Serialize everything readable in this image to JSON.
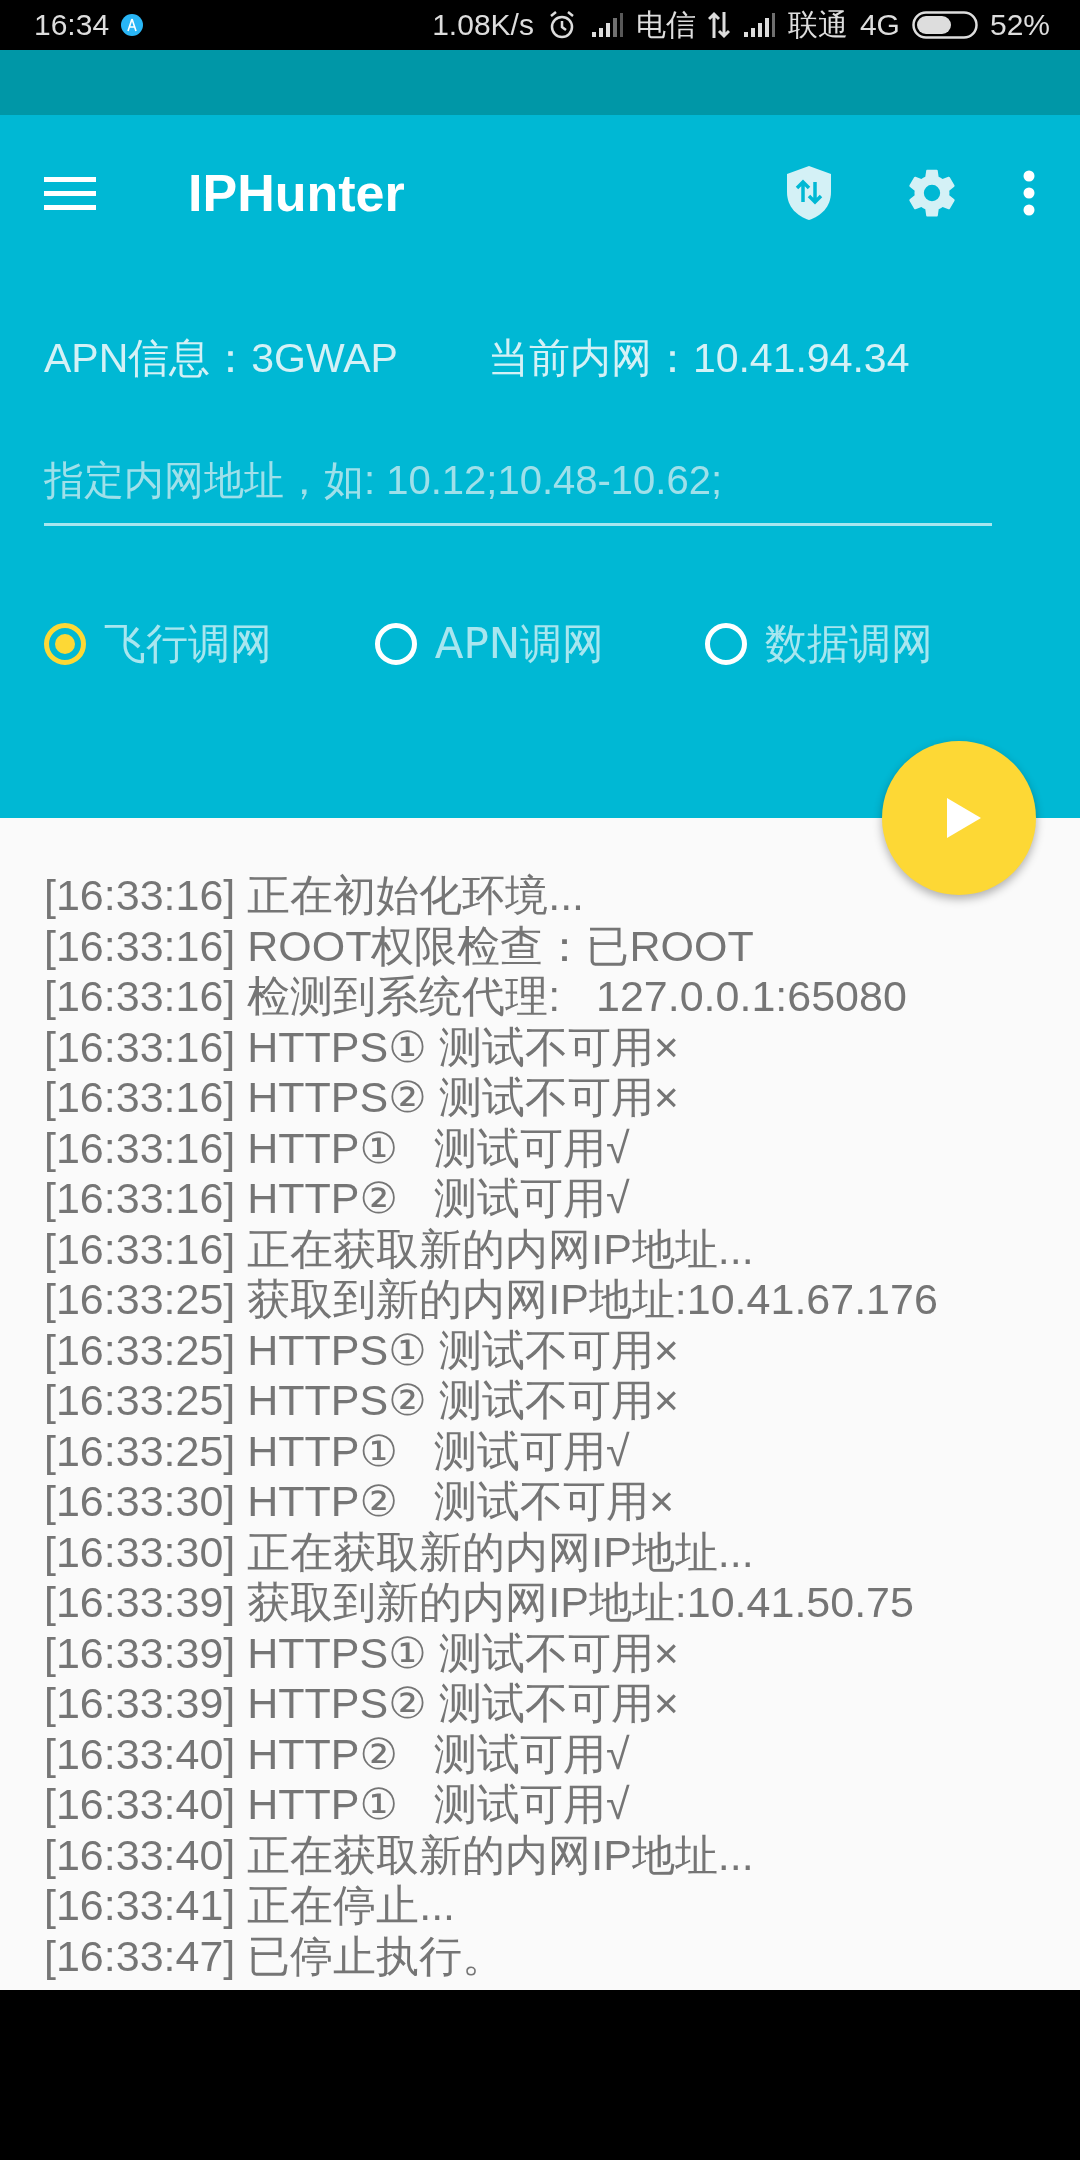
{
  "status_bar": {
    "time": "16:34",
    "speed": "1.08K/s",
    "carrier_1": "电信",
    "carrier_2": "联通",
    "network": "4G",
    "battery": "52%"
  },
  "toolbar": {
    "title": "IPHunter"
  },
  "info": {
    "apn": "APN信息：3GWAP",
    "intranet": "当前内网：10.41.94.34"
  },
  "address_field": {
    "placeholder": "指定内网地址，如: 10.12;10.48-10.62;"
  },
  "modes": [
    {
      "label": "飞行调网",
      "selected": true
    },
    {
      "label": "APN调网",
      "selected": false
    },
    {
      "label": "数据调网",
      "selected": false
    }
  ],
  "log": [
    "[16:33:16] 正在初始化环境...",
    "[16:33:16] ROOT权限检查：已ROOT",
    "[16:33:16] 检测到系统代理:   127.0.0.1:65080",
    "[16:33:16] HTTPS① 测试不可用×",
    "[16:33:16] HTTPS② 测试不可用×",
    "[16:33:16] HTTP①   测试可用√",
    "[16:33:16] HTTP②   测试可用√",
    "[16:33:16] 正在获取新的内网IP地址...",
    "[16:33:25] 获取到新的内网IP地址:10.41.67.176",
    "[16:33:25] HTTPS① 测试不可用×",
    "[16:33:25] HTTPS② 测试不可用×",
    "[16:33:25] HTTP①   测试可用√",
    "[16:33:30] HTTP②   测试不可用×",
    "[16:33:30] 正在获取新的内网IP地址...",
    "[16:33:39] 获取到新的内网IP地址:10.41.50.75",
    "[16:33:39] HTTPS① 测试不可用×",
    "[16:33:39] HTTPS② 测试不可用×",
    "[16:33:40] HTTP②   测试可用√",
    "[16:33:40] HTTP①   测试可用√",
    "[16:33:40] 正在获取新的内网IP地址...",
    "[16:33:41] 正在停止...",
    "[16:33:47] 已停止执行。"
  ]
}
